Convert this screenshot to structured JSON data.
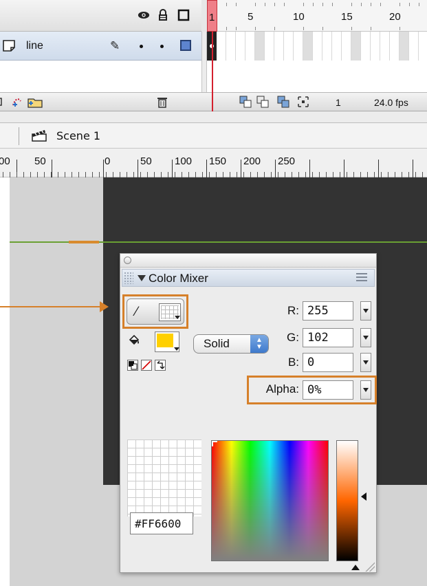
{
  "timeline": {
    "frame_numbers": [
      "1",
      "5",
      "10",
      "15",
      "20"
    ],
    "layer": {
      "name": "line",
      "outline_color": "#5d84cf"
    },
    "current_frame": "1",
    "frame_rate": "24.0 fps",
    "icons": {
      "eye": "eye-icon",
      "lock": "lock-icon",
      "outline": "outline-icon",
      "pencil": "pencil-icon",
      "trash": "trash-icon"
    }
  },
  "scene": {
    "label": "Scene 1"
  },
  "ruler": {
    "labels": [
      "00",
      "50",
      "0",
      "50",
      "100",
      "150",
      "200",
      "250"
    ]
  },
  "stage": {
    "background": "#333333",
    "line_color": "#6aa033",
    "selected_segment_color": "#d98b2e"
  },
  "mixer": {
    "title": "Color Mixer",
    "fill_type": "Solid",
    "fill_color": "#ffd000",
    "r_label": "R:",
    "g_label": "G:",
    "b_label": "B:",
    "alpha_label": "Alpha:",
    "r": "255",
    "g": "102",
    "b": "0",
    "alpha": "0%",
    "hex": "#FF6600",
    "highlight_color": "#d6802a"
  }
}
